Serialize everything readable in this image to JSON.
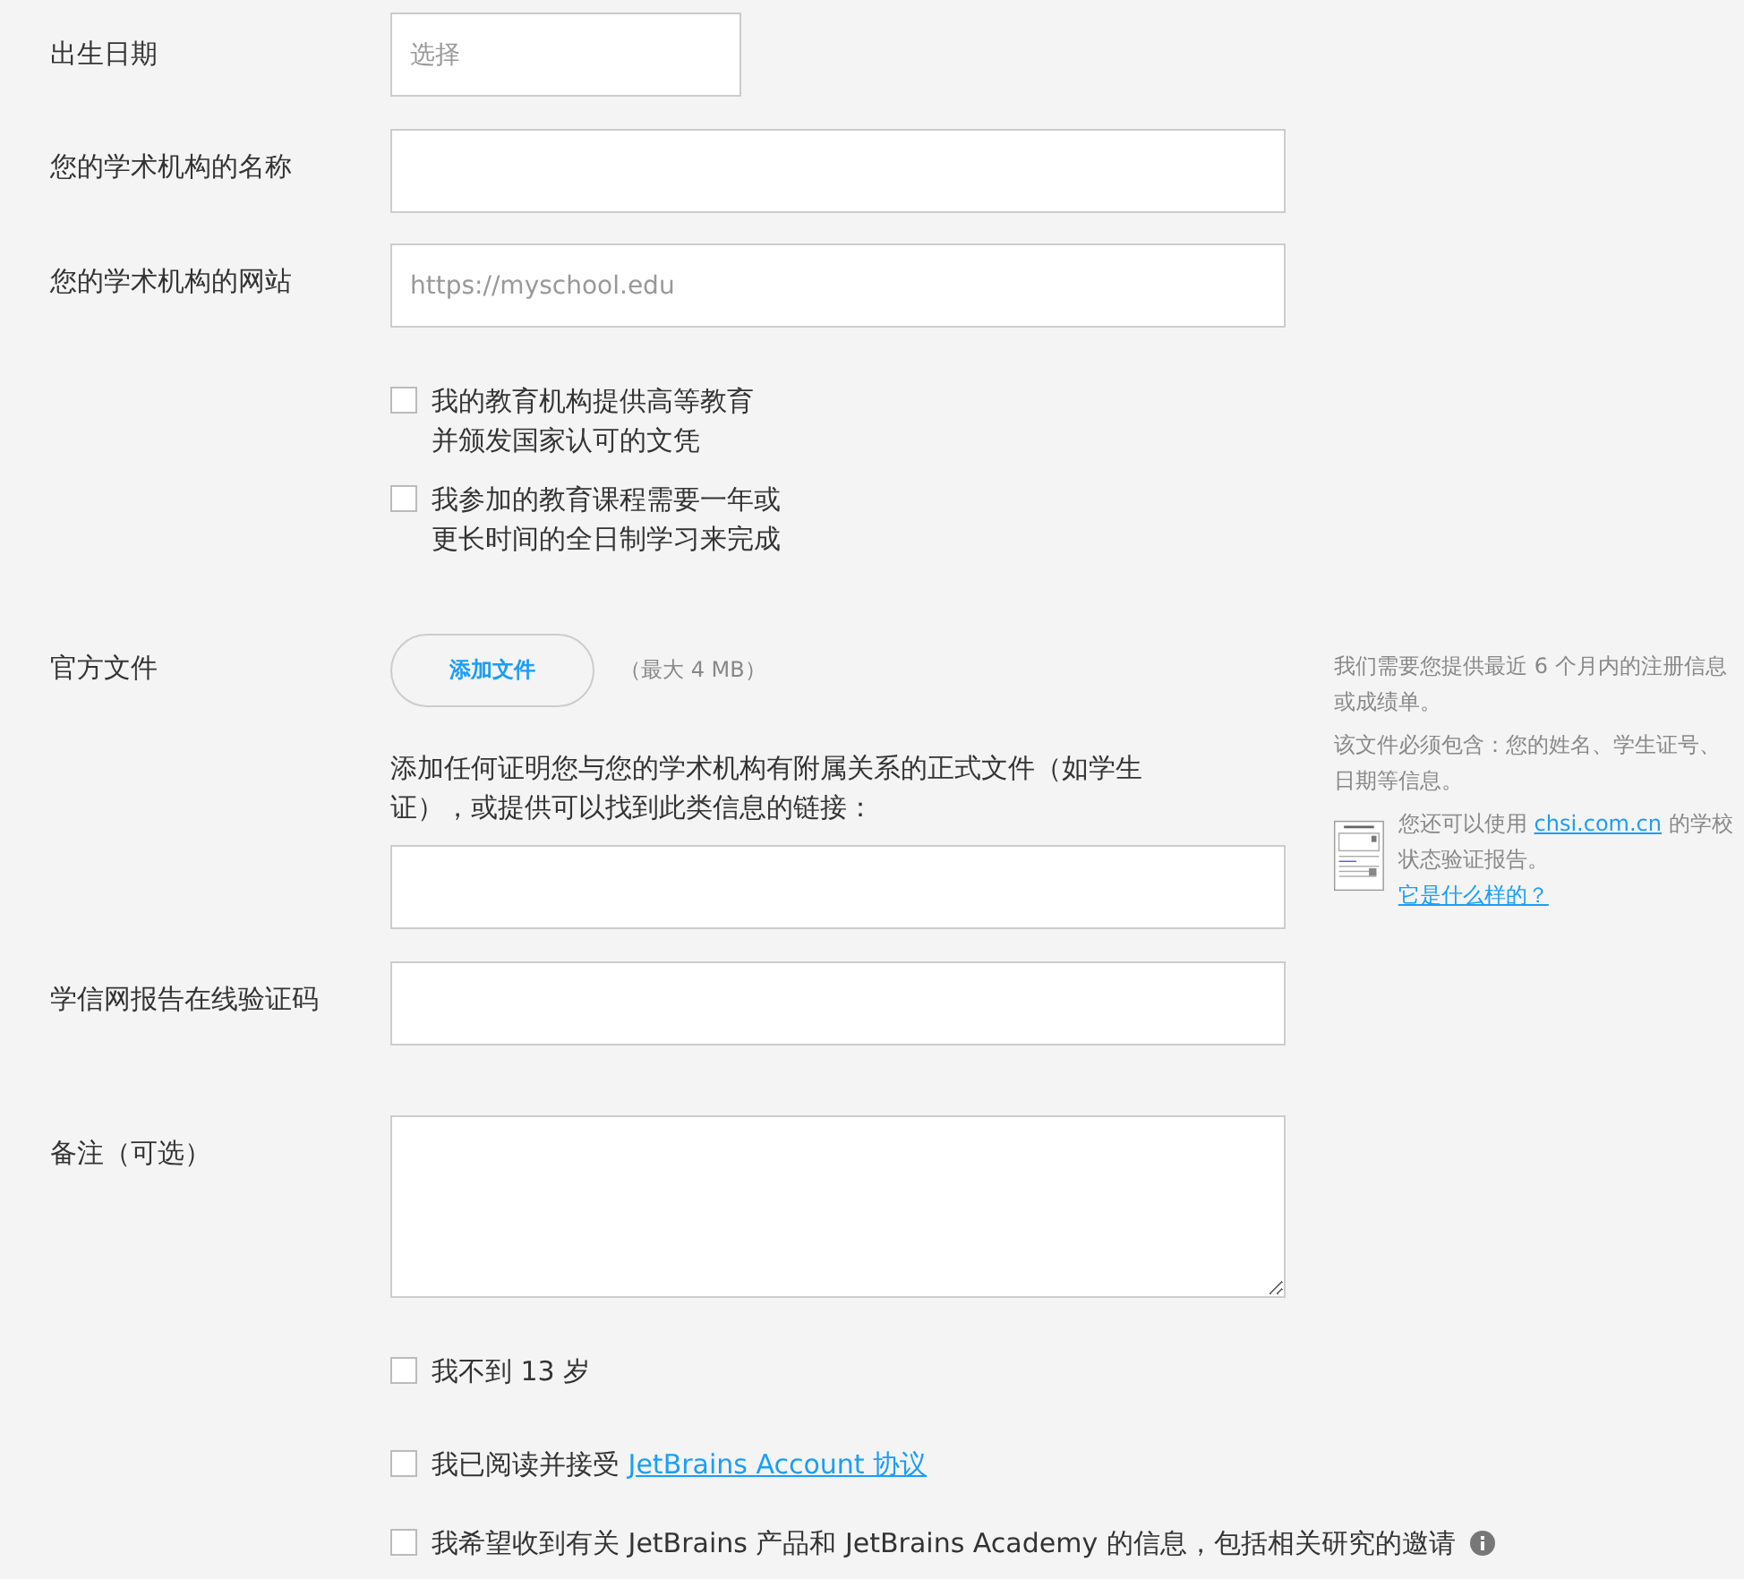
{
  "birth_date": {
    "label": "出生日期",
    "placeholder": "选择"
  },
  "institution_name": {
    "label": "您的学术机构的名称"
  },
  "institution_website": {
    "label": "您的学术机构的网站",
    "placeholder": "https://myschool.edu"
  },
  "eligibility_checks": [
    {
      "lines": [
        "我的教育机构提供高等教育",
        "并颁发国家认可的文凭"
      ],
      "checked": false
    },
    {
      "lines": [
        "我参加的教育课程需要一年或",
        "更长时间的全日制学习来完成"
      ],
      "checked": false
    }
  ],
  "official_document": {
    "label": "官方文件",
    "button": "添加文件",
    "size_hint": "（最大 4 MB）",
    "description": "添加任何证明您与您的学术机构有附属关系的正式文件（如学生证），或提供可以找到此类信息的链接："
  },
  "sidebar": {
    "requirement": "我们需要您提供最近 6 个月内的注册信息或成绩单。",
    "contents": "该文件必须包含：您的姓名、学生证号、日期等信息。",
    "alt_before": "您还可以使用 ",
    "alt_link": "chsi.com.cn",
    "alt_after": " 的学校状态验证报告。",
    "example_link": "它是什么样的？"
  },
  "verification_code": {
    "label": "学信网报告在线验证码"
  },
  "notes": {
    "label": "备注（可选）"
  },
  "agreements": [
    {
      "text": "我不到 13 岁",
      "checked": false
    },
    {
      "text": "我已阅读并接受 ",
      "link": "JetBrains Account 协议",
      "checked": false
    },
    {
      "text": "我希望收到有关 JetBrains 产品和 JetBrains Academy 的信息，包括相关研究的邀请",
      "checked": false,
      "info": true
    }
  ]
}
